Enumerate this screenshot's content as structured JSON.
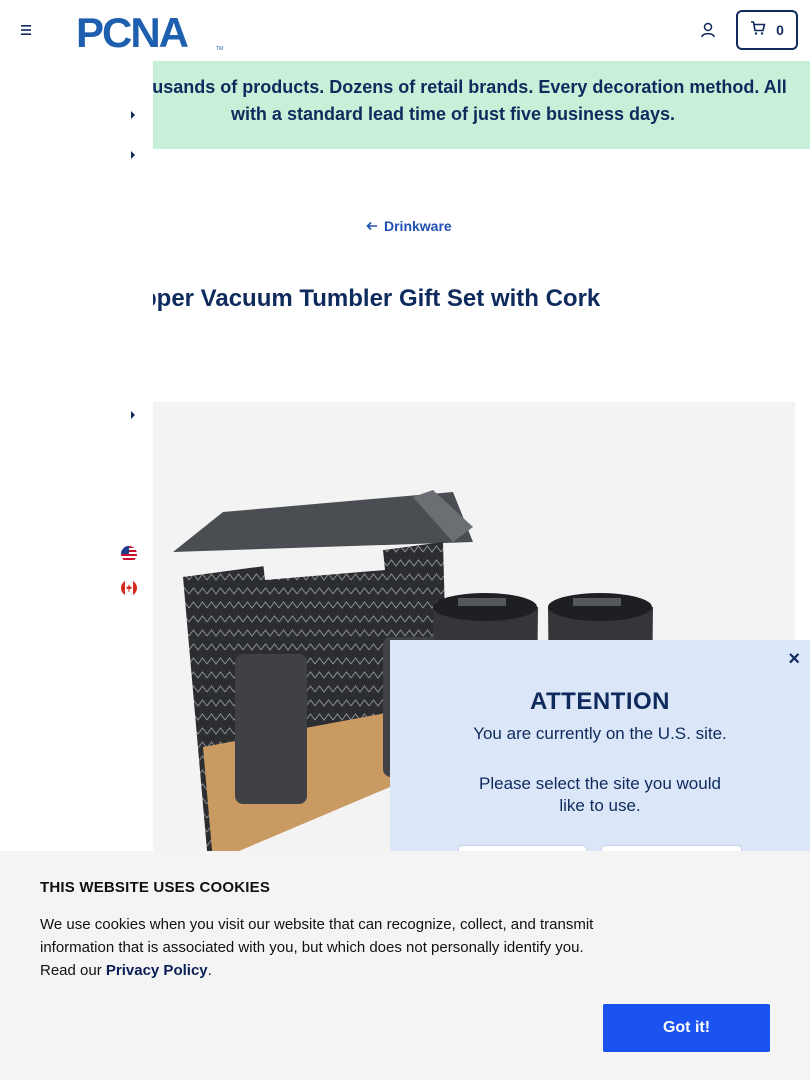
{
  "header": {
    "menu_icon": "hamburger-menu-icon",
    "logo_text": "PCNA",
    "logo_tm": "TM",
    "account_icon": "user-icon",
    "cart_icon": "cart-icon",
    "cart_count": "0",
    "brand_color": "#0f2a5c",
    "accent_color": "#1f4fb4"
  },
  "banner": {
    "text": "Thousands of products. Dozens of retail brands. Every decoration method. All with a standard lead time of just five business days.",
    "background": "#c7f0d9"
  },
  "breadcrumb": {
    "label": "Drinkware",
    "icon": "arrow-left-icon"
  },
  "product": {
    "title": "Copper Vacuum Tumbler Gift Set with Cork"
  },
  "site_modal": {
    "close_label": "×",
    "title": "ATTENTION",
    "current_site": "You are currently on the U.S. site.",
    "prompt": "Please select the site you would like to use.",
    "flags": [
      "us-flag-icon",
      "canada-flag-icon"
    ]
  },
  "cookie_banner": {
    "title": "THIS WEBSITE USES COOKIES",
    "text": "We use cookies when you visit our website that can recognize, collect, and transmit information that is associated with you, but which does not personally identify you. Read our",
    "link_label": "Privacy Policy",
    "trailing": ".",
    "accept_label": "Got it!",
    "button_color": "#1a53f0"
  }
}
